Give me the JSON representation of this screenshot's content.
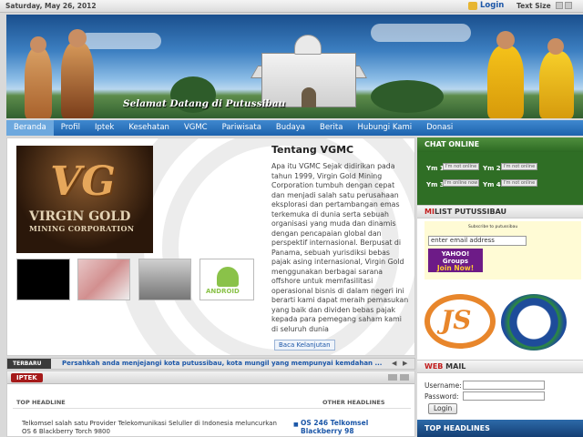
{
  "topbar": {
    "date": "Saturday, May 26, 2012",
    "login_label": "Login",
    "text_size_label": "Text Size"
  },
  "banner": {
    "welcome_text": "Selamat Datang di Putussibau"
  },
  "nav": {
    "items": [
      "Beranda",
      "Profil",
      "Iptek",
      "Kesehatan",
      "VGMC",
      "Pariwisata",
      "Budaya",
      "Berita",
      "Hubungi Kami",
      "Donasi"
    ],
    "active_index": 0
  },
  "feature": {
    "logo_text_line1": "VIRGIN GOLD",
    "logo_text_line2": "MINING CORPORATION",
    "logo_mark": "VG",
    "android_label": "ANDROID",
    "title": "Tentang VGMC",
    "body": "Apa itu VGMC Sejak didirikan pada tahun 1999, Virgin Gold Mining Corporation tumbuh dengan cepat dan menjadi salah satu perusahaan eksplorasi dan pertambangan emas terkemuka di dunia serta sebuah organisasi yang muda dan dinamis dengan pencapaian global dan perspektif internasional. Berpusat di Panama, sebuah yurisdiksi bebas pajak asing internasional, Virgin Gold menggunakan berbagai sarana offshore untuk memfasilitasi operasional bisnis di dalam negeri ini berarti kami dapat meraih pemasukan yang baik dan dividen bebas pajak kepada para pemegang saham kami di seluruh dunia",
    "read_more": "Baca Kelanjutan"
  },
  "ticker": {
    "tag": "TERBARU",
    "text": "Persahkah anda menjejangi kota putussibau, kota mungil yang mempunyai kemdahan ..."
  },
  "iptek": {
    "label": "IPTEK",
    "top_headline_label": "TOP HEADLINE",
    "other_headlines_label": "OTHER HEADLINES",
    "top_news": "Telkomsel salah satu Provider Telekomunikasi Seluller di Indonesia meluncurkan OS 6 Blackberry Torch 9800",
    "other_news": "OS 246 Telkomsel Blackberry 98"
  },
  "sidebar": {
    "chat_title": "CHAT ONLINE",
    "ym": [
      {
        "label": "Ym 1",
        "status": "I'm not online"
      },
      {
        "label": "Ym 2",
        "status": "I'm not online"
      },
      {
        "label": "Ym 3",
        "status": "I'm online now"
      },
      {
        "label": "Ym 4",
        "status": "I'm not online"
      }
    ],
    "milist_title_red": "MI",
    "milist_title_rest": "LIST PUTUSSIBAU",
    "subscribe_label": "Subscribe to putussibau",
    "email_placeholder": "enter email address",
    "yahoo_line1": "YAHOO!",
    "yahoo_line2": "Groups",
    "yahoo_join": "Join Now!",
    "emblem_text": "JS",
    "webmail_title_red": "WEB",
    "webmail_title_rest": " MAIL",
    "username_label": "Username:",
    "password_label": "Password:",
    "login_button": "Login",
    "top_headlines_title": "TOP HEADLINES"
  }
}
